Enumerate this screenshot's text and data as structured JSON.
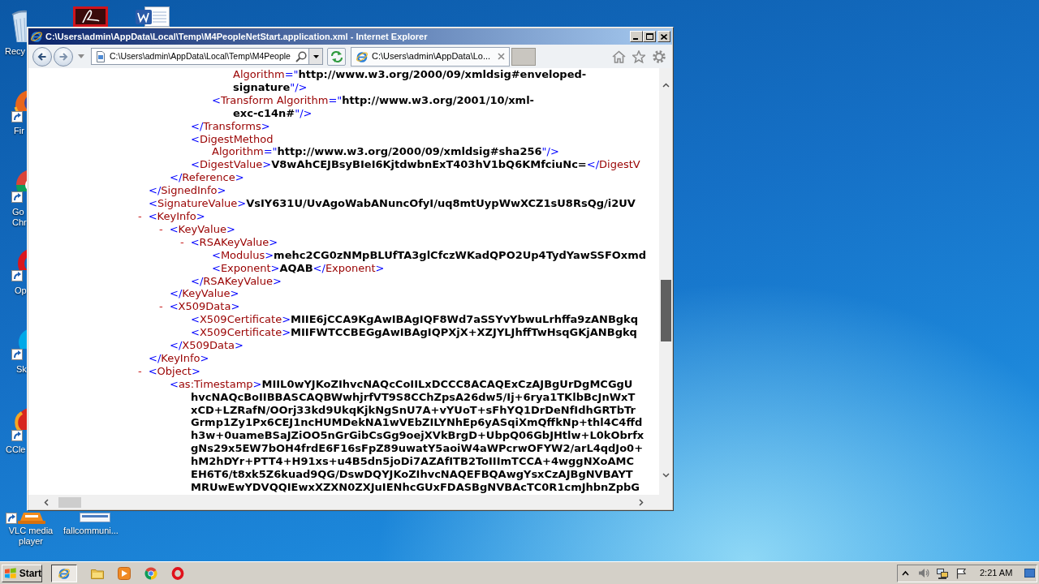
{
  "desktop_icons": [
    {
      "kind": "trash",
      "label": "Recy",
      "shortcut": false
    },
    {
      "kind": "tile",
      "shortcut": false
    },
    {
      "kind": "document",
      "shortcut": false
    },
    {
      "kind": "fox",
      "label": "Fir",
      "shortcut": true
    },
    {
      "kind": "wheel",
      "label": "Go Chr",
      "shortcut": true
    },
    {
      "kind": "ring",
      "label": "Op",
      "shortcut": true
    },
    {
      "kind": "cloud",
      "label": "Sk",
      "shortcut": true
    },
    {
      "kind": "cleaner",
      "label": "CCle",
      "shortcut": true
    },
    {
      "kind": "cone",
      "label": "VLC media player",
      "shortcut": true
    },
    {
      "kind": "file",
      "label": "fallcommuni...",
      "shortcut": false
    }
  ],
  "window": {
    "title": "C:\\Users\\admin\\AppData\\Local\\Temp\\M4PeopleNetStart.application.xml - Internet Explorer"
  },
  "toolbar": {
    "address": "C:\\Users\\admin\\AppData\\Local\\Temp\\M4People",
    "tabs": [
      {
        "title": "C:\\Users\\admin\\AppData\\Lo...",
        "selected": true
      }
    ]
  },
  "document": {
    "children": [
      {
        "children": [
          {
            "children": [
              {
                "children": [
                  {
                    "wrap": [
                      [
                        {
                          "kind": "name",
                          "text": "Algorithm"
                        },
                        {
                          "kind": "punct",
                          "text": "=\""
                        },
                        {
                          "kind": "value",
                          "text": "http://www.w3.org/2000/09/xmldsig#enveloped-"
                        }
                      ],
                      [
                        {
                          "kind": "value",
                          "text": "signature"
                        },
                        {
                          "kind": "punct",
                          "text": "\"/>"
                        }
                      ]
                    ]
                  },
                  {
                    "head": [
                      {
                        "kind": "punct",
                        "text": "<"
                      },
                      {
                        "kind": "name",
                        "text": "Transform Algorithm"
                      },
                      {
                        "kind": "punct",
                        "text": "=\""
                      },
                      {
                        "kind": "value",
                        "text": "http://www.w3.org/2001/10/xml-"
                      }
                    ],
                    "wrap": [
                      [
                        {
                          "kind": "value",
                          "text": "exc-c14n#"
                        },
                        {
                          "kind": "punct",
                          "text": "\"/>"
                        }
                      ]
                    ]
                  }
                ],
                "close": [
                  {
                    "kind": "punct",
                    "text": "</"
                  },
                  {
                    "kind": "name",
                    "text": "Transforms"
                  },
                  {
                    "kind": "punct",
                    "text": ">"
                  }
                ]
              },
              {
                "head": [
                  {
                    "kind": "punct",
                    "text": "<"
                  },
                  {
                    "kind": "name",
                    "text": "DigestMethod"
                  }
                ],
                "wrap": [
                  [
                    {
                      "kind": "name",
                      "text": "Algorithm"
                    },
                    {
                      "kind": "punct",
                      "text": "=\""
                    },
                    {
                      "kind": "value",
                      "text": "http://www.w3.org/2000/09/xmldsig#sha256"
                    },
                    {
                      "kind": "punct",
                      "text": "\"/>"
                    }
                  ]
                ]
              },
              {
                "head": [
                  {
                    "kind": "punct",
                    "text": "<"
                  },
                  {
                    "kind": "name",
                    "text": "DigestValue"
                  },
                  {
                    "kind": "punct",
                    "text": ">"
                  },
                  {
                    "kind": "value",
                    "text": "V8wAhCEJBsyBIeI6KjtdwbnExT403hV1bQ6KMfciuNc="
                  },
                  {
                    "kind": "punct",
                    "text": "</"
                  },
                  {
                    "kind": "name",
                    "text": "DigestV"
                  }
                ]
              }
            ],
            "close": [
              {
                "kind": "punct",
                "text": "</"
              },
              {
                "kind": "name",
                "text": "Reference"
              },
              {
                "kind": "punct",
                "text": ">"
              }
            ]
          }
        ],
        "close": [
          {
            "kind": "punct",
            "text": "</"
          },
          {
            "kind": "name",
            "text": "SignedInfo"
          },
          {
            "kind": "punct",
            "text": ">"
          }
        ]
      },
      {
        "head": [
          {
            "kind": "punct",
            "text": "<"
          },
          {
            "kind": "name",
            "text": "SignatureValue"
          },
          {
            "kind": "punct",
            "text": ">"
          },
          {
            "kind": "value",
            "text": "VsIY631U/UvAgoWabANuncOfyI/uq8mtUypWwXCZ1sU8RsQg/i2UV"
          }
        ]
      },
      {
        "toggle": "-",
        "head": [
          {
            "kind": "punct",
            "text": "<"
          },
          {
            "kind": "name",
            "text": "KeyInfo"
          },
          {
            "kind": "punct",
            "text": ">"
          }
        ],
        "children": [
          {
            "toggle": "-",
            "head": [
              {
                "kind": "punct",
                "text": "<"
              },
              {
                "kind": "name",
                "text": "KeyValue"
              },
              {
                "kind": "punct",
                "text": ">"
              }
            ],
            "children": [
              {
                "toggle": "-",
                "head": [
                  {
                    "kind": "punct",
                    "text": "<"
                  },
                  {
                    "kind": "name",
                    "text": "RSAKeyValue"
                  },
                  {
                    "kind": "punct",
                    "text": ">"
                  }
                ],
                "children": [
                  {
                    "head": [
                      {
                        "kind": "punct",
                        "text": "<"
                      },
                      {
                        "kind": "name",
                        "text": "Modulus"
                      },
                      {
                        "kind": "punct",
                        "text": ">"
                      },
                      {
                        "kind": "value",
                        "text": "mehc2CG0zNMpBLUfTA3glCfczWKadQPO2Up4TydYawSSFOxmd"
                      }
                    ]
                  },
                  {
                    "head": [
                      {
                        "kind": "punct",
                        "text": "<"
                      },
                      {
                        "kind": "name",
                        "text": "Exponent"
                      },
                      {
                        "kind": "punct",
                        "text": ">"
                      },
                      {
                        "kind": "value",
                        "text": "AQAB"
                      },
                      {
                        "kind": "punct",
                        "text": "</"
                      },
                      {
                        "kind": "name",
                        "text": "Exponent"
                      },
                      {
                        "kind": "punct",
                        "text": ">"
                      }
                    ]
                  }
                ],
                "close": [
                  {
                    "kind": "punct",
                    "text": "</"
                  },
                  {
                    "kind": "name",
                    "text": "RSAKeyValue"
                  },
                  {
                    "kind": "punct",
                    "text": ">"
                  }
                ]
              }
            ],
            "close": [
              {
                "kind": "punct",
                "text": "</"
              },
              {
                "kind": "name",
                "text": "KeyValue"
              },
              {
                "kind": "punct",
                "text": ">"
              }
            ]
          },
          {
            "toggle": "-",
            "head": [
              {
                "kind": "punct",
                "text": "<"
              },
              {
                "kind": "name",
                "text": "X509Data"
              },
              {
                "kind": "punct",
                "text": ">"
              }
            ],
            "children": [
              {
                "head": [
                  {
                    "kind": "punct",
                    "text": "<"
                  },
                  {
                    "kind": "name",
                    "text": "X509Certificate"
                  },
                  {
                    "kind": "punct",
                    "text": ">"
                  },
                  {
                    "kind": "value",
                    "text": "MIIE6jCCA9KgAwIBAgIQF8Wd7aSSYvYbwuLrhffa9zANBgkq"
                  }
                ]
              },
              {
                "head": [
                  {
                    "kind": "punct",
                    "text": "<"
                  },
                  {
                    "kind": "name",
                    "text": "X509Certificate"
                  },
                  {
                    "kind": "punct",
                    "text": ">"
                  },
                  {
                    "kind": "value",
                    "text": "MIIFWTCCBEGgAwIBAgIQPXjX+XZJYLJhffTwHsqGKjANBgkq"
                  }
                ]
              }
            ],
            "close": [
              {
                "kind": "punct",
                "text": "</"
              },
              {
                "kind": "name",
                "text": "X509Data"
              },
              {
                "kind": "punct",
                "text": ">"
              }
            ]
          }
        ],
        "close": [
          {
            "kind": "punct",
            "text": "</"
          },
          {
            "kind": "name",
            "text": "KeyInfo"
          },
          {
            "kind": "punct",
            "text": ">"
          }
        ]
      },
      {
        "toggle": "-",
        "head": [
          {
            "kind": "punct",
            "text": "<"
          },
          {
            "kind": "name",
            "text": "Object"
          },
          {
            "kind": "punct",
            "text": ">"
          }
        ],
        "children": [
          {
            "head": [
              {
                "kind": "punct",
                "text": "<"
              },
              {
                "kind": "name",
                "text": "as:Timestamp"
              },
              {
                "kind": "punct",
                "text": ">"
              },
              {
                "kind": "value",
                "text": "MIIL0wYJKoZIhvcNAQcCoIILxDCCC8ACAQExCzAJBgUrDgMCGgU"
              }
            ],
            "wrap": [
              [
                {
                  "kind": "value",
                  "text": "hvcNAQcBoIIBBASCAQBWwhjrfVT9S8CChZpsA26dw5/Ij+6rya1TKlbBcJnWxT"
                }
              ],
              [
                {
                  "kind": "value",
                  "text": "xCD+LZRafN/OOrj33kd9UkqKjkNgSnU7A+vYUoT+sFhYQ1DrDeNfIdhGRTbTr"
                }
              ],
              [
                {
                  "kind": "value",
                  "text": "Grmp1Zy1Px6CEJ1ncHUMDekNA1wVEbZILYNhEp6yASqiXmQffkNp+thl4C4ffd"
                }
              ],
              [
                {
                  "kind": "value",
                  "text": "h3w+0uameBSaJZiOO5nGrGibCsGg9oejXVkBrgD+UbpQ06GbJHtlw+L0kObrfx"
                }
              ],
              [
                {
                  "kind": "value",
                  "text": "gNs29x5EW7bOH4frdE6F16sFpZ89uwatY5aoiW4aWPcrwOFYW2/arL4qdJo0+"
                }
              ],
              [
                {
                  "kind": "value",
                  "text": "hM2hDYr+PTT4+H91xs+u4B5dn5joDi7AZAfITB2ToIIImTCCA+4wggNXoAMC"
                }
              ],
              [
                {
                  "kind": "value",
                  "text": "EH6T6/t8xk5Z6kuad9QG/DswDQYJKoZIhvcNAQEFBQAwgYsxCzAJBgNVBAYT"
                }
              ],
              [
                {
                  "kind": "value",
                  "text": "MRUwEwYDVQQIEwxXZXN0ZXJuIENhcGUxFDASBgNVBAcTC0R1cmJhbnZpbG"
                }
              ]
            ]
          }
        ]
      }
    ]
  },
  "taskbar": {
    "start": "Start",
    "apps": [
      {
        "kind": "e_logo",
        "active": true
      },
      {
        "kind": "folder",
        "active": false
      },
      {
        "kind": "player",
        "active": false
      },
      {
        "kind": "wheel",
        "active": false
      },
      {
        "kind": "ring",
        "active": false
      }
    ],
    "clock": "2:21 AM"
  }
}
